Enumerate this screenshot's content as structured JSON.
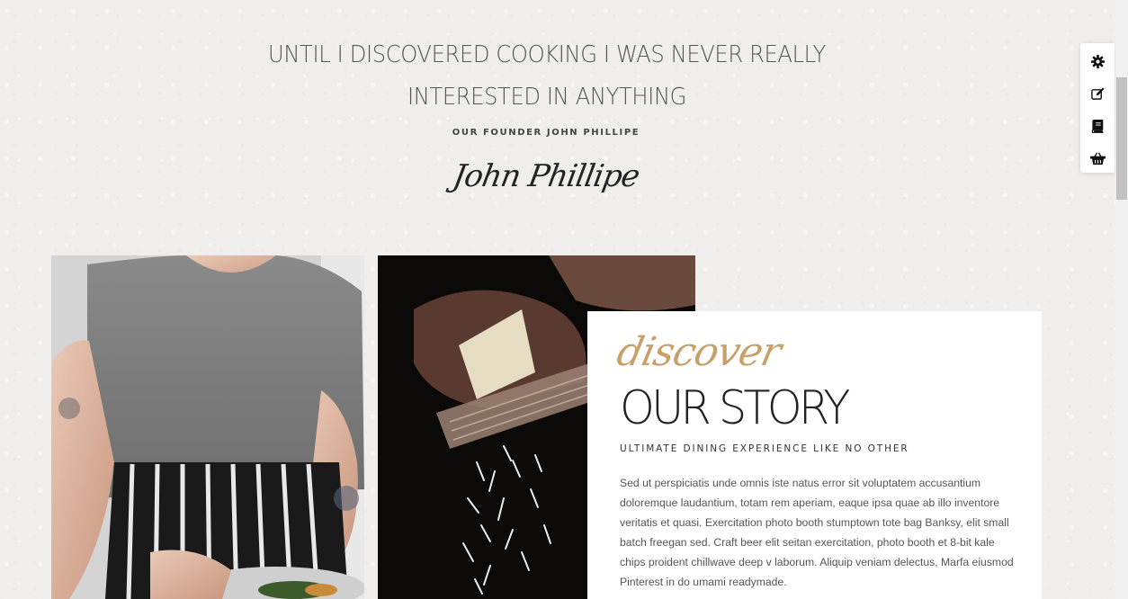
{
  "quote": {
    "line1": "UNTIL I DISCOVERED COOKING I WAS NEVER REALLY",
    "line2": "INTERESTED IN ANYTHING"
  },
  "founder_caption": "OUR FOUNDER JOHN PHILLIPE",
  "signature": "John Phillipe",
  "story": {
    "script_word": "discover",
    "title": "OUR STORY",
    "subtitle": "ULTIMATE DINING EXPERIENCE LIKE NO OTHER",
    "body": "Sed ut perspiciatis unde omnis iste natus error sit voluptatem accusantium doloremque laudantium, totam rem aperiam, eaque ipsa quae ab illo inventore veritatis et quasi. Exercitation photo booth stumptown tote bag Banksy, elit small batch freegan sed. Craft beer elit seitan exercitation, photo booth et 8-bit kale chips proident chillwave deep v laborum. Aliquip veniam delectus, Marfa eiusmod Pinterest in do umami readymade."
  },
  "toolbar": {
    "icons": [
      "gear-icon",
      "edit-icon",
      "book-icon",
      "basket-icon"
    ]
  },
  "colors": {
    "accent_gold": "#c7a06a",
    "background": "#efeeec"
  }
}
